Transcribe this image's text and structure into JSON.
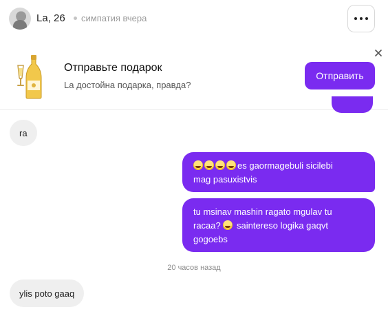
{
  "header": {
    "name": "La, 26",
    "status": "симпатия вчера"
  },
  "gift_banner": {
    "title": "Отправьте подарок",
    "subtitle": "La достойна подарка, правда?",
    "send_label": "Отправить"
  },
  "messages": [
    {
      "direction": "in",
      "text": "ra"
    },
    {
      "direction": "out",
      "emoji_count": 4,
      "text_line1": "es gaormagebuli sicilebi",
      "text_line2": "mag pasuxistvis"
    },
    {
      "direction": "out",
      "line1": "tu msinav mashin ragato mgulav tu",
      "line2_before": "racaa? ",
      "line2_after": " saintereso logika gaqvt",
      "line3": "gogoebs"
    },
    {
      "direction": "in",
      "text": "ylis poto gaaq"
    }
  ],
  "separator": "20 часов назад",
  "colors": {
    "accent": "#7a2bf0",
    "incoming_bubble": "#efefef"
  },
  "icons": [
    "more-icon",
    "close-icon",
    "champagne-bottle-icon",
    "laughing-emoji",
    "grinning-emoji"
  ]
}
